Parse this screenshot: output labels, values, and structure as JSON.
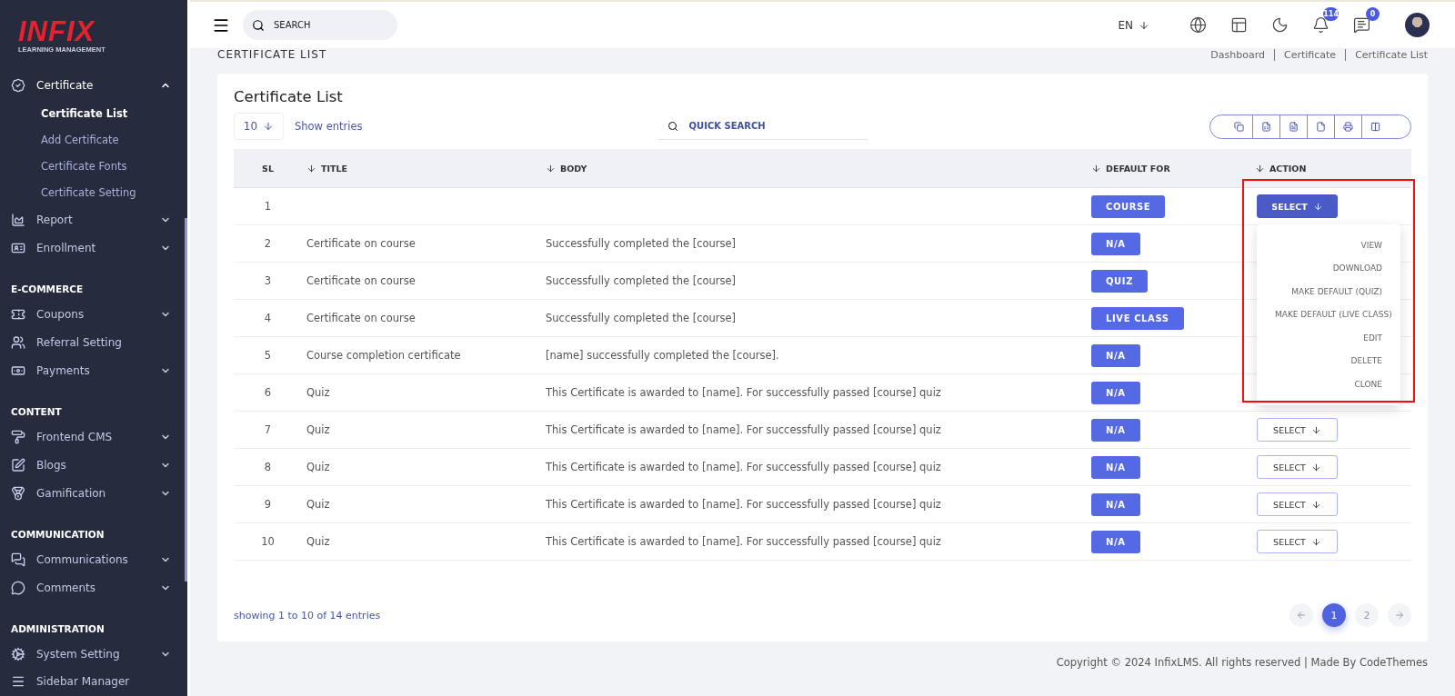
{
  "brand": {
    "name": "INFIX",
    "tagline": "LEARNING MANAGEMENT"
  },
  "sidebar": {
    "items": [
      {
        "kind": "item",
        "label": "Certificate",
        "expanded": true,
        "children": [
          {
            "label": "Certificate List",
            "selected": true
          },
          {
            "label": "Add Certificate",
            "selected": false
          },
          {
            "label": "Certificate Fonts",
            "selected": false
          },
          {
            "label": "Certificate Setting",
            "selected": false
          }
        ]
      },
      {
        "kind": "item",
        "label": "Report",
        "expanded": false
      },
      {
        "kind": "item",
        "label": "Enrollment",
        "expanded": false
      },
      {
        "kind": "section",
        "label": "E-COMMERCE"
      },
      {
        "kind": "item",
        "label": "Coupons",
        "expanded": false
      },
      {
        "kind": "item",
        "label": "Referral Setting"
      },
      {
        "kind": "item",
        "label": "Payments",
        "expanded": false
      },
      {
        "kind": "section",
        "label": "CONTENT"
      },
      {
        "kind": "item",
        "label": "Frontend CMS",
        "expanded": false
      },
      {
        "kind": "item",
        "label": "Blogs",
        "expanded": false
      },
      {
        "kind": "item",
        "label": "Gamification",
        "expanded": false
      },
      {
        "kind": "section",
        "label": "COMMUNICATION"
      },
      {
        "kind": "item",
        "label": "Communications",
        "expanded": false
      },
      {
        "kind": "item",
        "label": "Comments",
        "expanded": false
      },
      {
        "kind": "section",
        "label": "ADMINISTRATION"
      },
      {
        "kind": "item",
        "label": "System Setting",
        "expanded": false
      },
      {
        "kind": "item",
        "label": "Sidebar Manager"
      }
    ]
  },
  "header": {
    "search": {
      "placeholder": "SEARCH"
    },
    "language": "EN",
    "notifications": "114",
    "messages": "0"
  },
  "page": {
    "title": "CERTIFICATE LIST",
    "breadcrumbs": [
      "Dashboard",
      "Certificate",
      "Certificate List"
    ]
  },
  "card": {
    "title": "Certificate List",
    "page_size": "10",
    "show_entries": "Show entries",
    "quick_search": {
      "placeholder": "QUICK SEARCH"
    },
    "columns": [
      {
        "label": "SL",
        "sortable": false
      },
      {
        "label": "TITLE",
        "sortable": true
      },
      {
        "label": "BODY",
        "sortable": true
      },
      {
        "label": "DEFAULT FOR",
        "sortable": true
      },
      {
        "label": "ACTION",
        "sortable": true
      }
    ],
    "rows": [
      {
        "sl": "1",
        "default_for": "COURSE",
        "action": "SELECT",
        "menu_open": true
      },
      {
        "sl": "2",
        "title": "Certificate on course",
        "body": "Successfully completed the [course]",
        "default_for": "N/A"
      },
      {
        "sl": "3",
        "title": "Certificate on course",
        "body": "Successfully completed the [course]",
        "default_for": "QUIZ"
      },
      {
        "sl": "4",
        "title": "Certificate on course",
        "body": "Successfully completed the [course]",
        "default_for": "LIVE CLASS"
      },
      {
        "sl": "5",
        "title": "Course completion certificate",
        "body": "[name] successfully completed the [course].",
        "default_for": "N/A"
      },
      {
        "sl": "6",
        "title": "Quiz",
        "body": "This Certificate is awarded to [name]. For successfully passed [course] quiz",
        "default_for": "N/A"
      },
      {
        "sl": "7",
        "title": "Quiz",
        "body": "This Certificate is awarded to [name]. For successfully passed [course] quiz",
        "default_for": "N/A",
        "action": "SELECT",
        "menu_open": false
      },
      {
        "sl": "8",
        "title": "Quiz",
        "body": "This Certificate is awarded to [name]. For successfully passed [course] quiz",
        "default_for": "N/A",
        "action": "SELECT",
        "menu_open": false
      },
      {
        "sl": "9",
        "title": "Quiz",
        "body": "This Certificate is awarded to [name]. For successfully passed [course] quiz",
        "default_for": "N/A",
        "action": "SELECT",
        "menu_open": false
      },
      {
        "sl": "10",
        "title": "Quiz",
        "body": "This Certificate is awarded to [name]. For successfully passed [course] quiz",
        "default_for": "N/A",
        "action": "SELECT",
        "menu_open": false
      }
    ],
    "action_menu": [
      "VIEW",
      "DOWNLOAD",
      "MAKE DEFAULT (QUIZ)",
      "MAKE DEFAULT (LIVE CLASS)",
      "EDIT",
      "DELETE",
      "CLONE"
    ],
    "summary": "showing 1 to 10 of 14 entries",
    "pages": [
      {
        "label": "1",
        "selected": true
      },
      {
        "label": "2",
        "selected": false
      }
    ]
  },
  "footer": "Copyright © 2024 InfixLMS. All rights reserved | Made By CodeThemes"
}
